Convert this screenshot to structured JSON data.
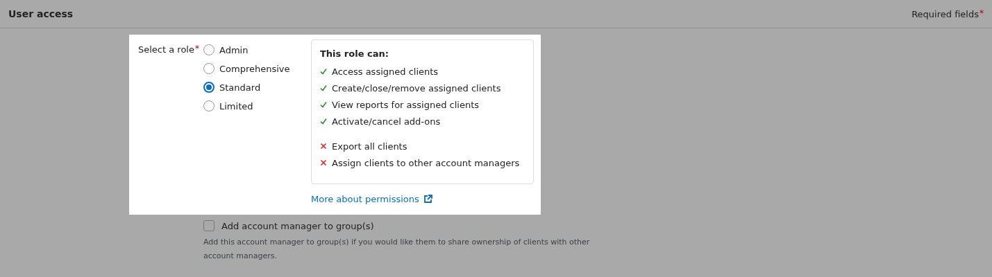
{
  "header": {
    "title": "User access",
    "required_note": "Required fields",
    "required_mark": "*"
  },
  "role": {
    "label": "Select a role",
    "required_mark": "*",
    "options": [
      {
        "label": "Admin",
        "selected": false
      },
      {
        "label": "Comprehensive",
        "selected": false
      },
      {
        "label": "Standard",
        "selected": true
      },
      {
        "label": "Limited",
        "selected": false
      }
    ]
  },
  "permissions": {
    "title": "This role can:",
    "items": [
      {
        "kind": "allowed",
        "text": "Access assigned clients"
      },
      {
        "kind": "allowed",
        "text": "Create/close/remove assigned clients"
      },
      {
        "kind": "allowed",
        "text": "View reports for assigned clients"
      },
      {
        "kind": "allowed",
        "text": "Activate/cancel add-ons"
      },
      {
        "kind": "denied",
        "text": "Export all clients"
      },
      {
        "kind": "denied",
        "text": "Assign clients to other account managers"
      }
    ],
    "link": "More about permissions"
  },
  "group": {
    "label": "Add account manager to group(s)",
    "checked": false,
    "help": "Add this account manager to group(s) if you would like them to share ownership of clients with other account managers."
  }
}
